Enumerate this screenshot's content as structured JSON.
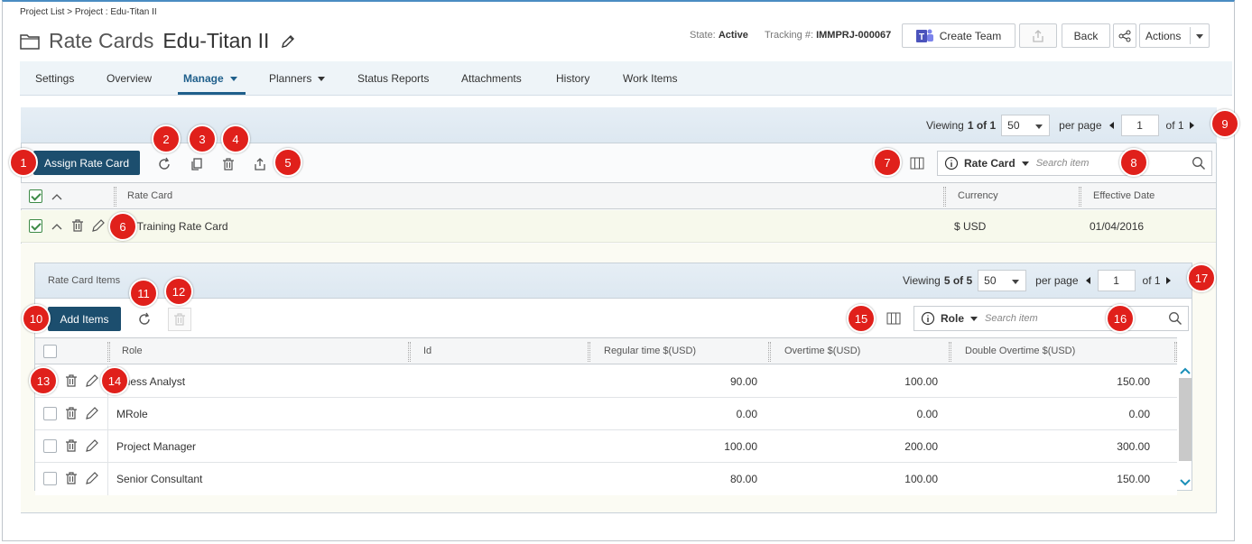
{
  "breadcrumb": "Project List > Project : Edu-Titan II",
  "header": {
    "title_prefix": "Rate Cards",
    "title_project": "Edu-Titan II",
    "state_label": "State:",
    "state_value": "Active",
    "tracking_label": "Tracking #:",
    "tracking_value": "IMMPRJ-000067",
    "create_team_label": "Create Team",
    "back_label": "Back",
    "actions_label": "Actions"
  },
  "nav": {
    "items": [
      "Settings",
      "Overview",
      "Manage",
      "Planners",
      "Status Reports",
      "Attachments",
      "History",
      "Work Items"
    ],
    "active": "Manage"
  },
  "rate_card_grid": {
    "viewing_label": "Viewing",
    "viewing_count": "1 of 1",
    "per_page_value": "50",
    "per_page_label": "per page",
    "page_value": "1",
    "page_of": "of 1",
    "assign_button": "Assign Rate Card",
    "search_category": "Rate Card",
    "search_placeholder": "Search item",
    "columns": [
      "Rate Card",
      "Currency",
      "Effective Date"
    ],
    "row": {
      "name": "uTraining Rate Card",
      "currency": "$ USD",
      "effective_date": "01/04/2016"
    }
  },
  "items_grid": {
    "title": "Rate Card Items",
    "viewing_label": "Viewing",
    "viewing_count": "5 of 5",
    "per_page_value": "50",
    "per_page_label": "per page",
    "page_value": "1",
    "page_of": "of 1",
    "add_button": "Add Items",
    "search_category": "Role",
    "search_placeholder": "Search item",
    "columns": [
      "Role",
      "Id",
      "Regular time $(USD)",
      "Overtime $(USD)",
      "Double Overtime $(USD)"
    ],
    "rows": [
      {
        "role": "siness Analyst",
        "id": "",
        "regular": "90.00",
        "overtime": "100.00",
        "double": "150.00"
      },
      {
        "role": "MRole",
        "id": "",
        "regular": "0.00",
        "overtime": "0.00",
        "double": "0.00"
      },
      {
        "role": "Project Manager",
        "id": "",
        "regular": "100.00",
        "overtime": "200.00",
        "double": "300.00"
      },
      {
        "role": "Senior Consultant",
        "id": "",
        "regular": "80.00",
        "overtime": "100.00",
        "double": "150.00"
      }
    ]
  },
  "badges": [
    "1",
    "2",
    "3",
    "4",
    "5",
    "6",
    "7",
    "8",
    "9",
    "10",
    "11",
    "12",
    "13",
    "14",
    "15",
    "16",
    "17"
  ],
  "colors": {
    "primary_button": "#1c4e6e",
    "active_nav": "#1f5f8b",
    "badge": "#e0201b",
    "check": "#3d8a47"
  }
}
